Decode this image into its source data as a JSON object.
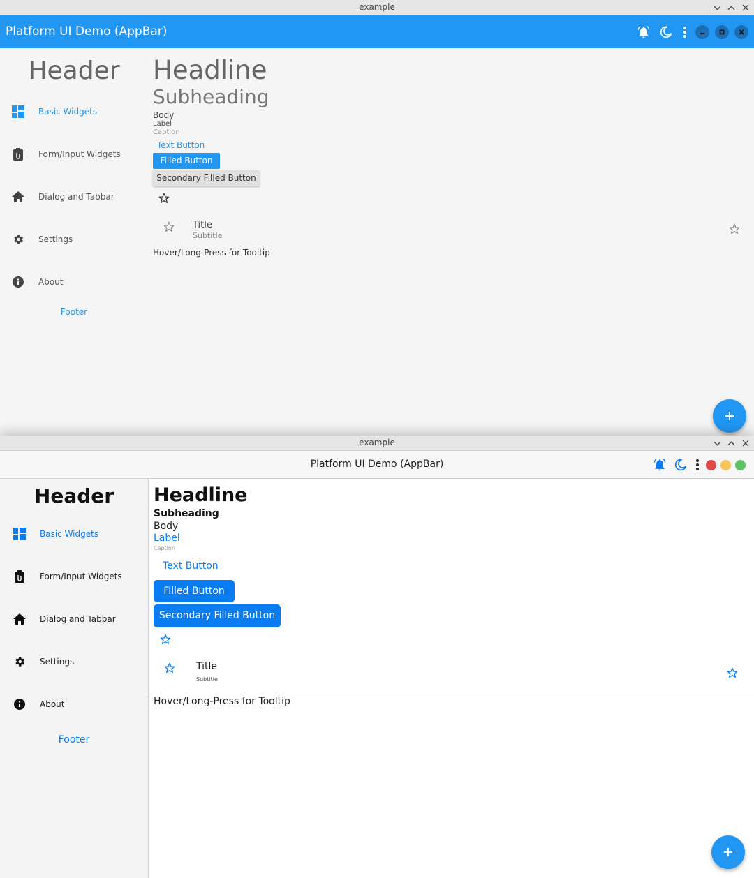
{
  "colors": {
    "accent": "#2196f3",
    "accent2": "#0a7cf2",
    "close_red": "#e54848",
    "min_yellow": "#f8c55a",
    "max_green": "#5cc266"
  },
  "window1": {
    "window_title": "example",
    "appbar_title": "Platform UI Demo (AppBar)",
    "sidebar": {
      "header": "Header",
      "items": [
        {
          "label": "Basic Widgets",
          "icon": "dashboard-icon"
        },
        {
          "label": "Form/Input Widgets",
          "icon": "clipboard-icon"
        },
        {
          "label": "Dialog and Tabbar",
          "icon": "home-icon"
        },
        {
          "label": "Settings",
          "icon": "gear-icon"
        },
        {
          "label": "About",
          "icon": "info-icon"
        }
      ],
      "footer": "Footer"
    },
    "content": {
      "headline": "Headline",
      "subheading": "Subheading",
      "body": "Body",
      "label": "Label",
      "caption": "Caption",
      "text_button": "Text Button",
      "filled_button": "Filled Button",
      "secondary_button": "Secondary Filled Button",
      "list_title": "Title",
      "list_subtitle": "Subtitle",
      "tooltip_text": "Hover/Long-Press for Tooltip"
    }
  },
  "window2": {
    "window_title": "example",
    "appbar_title": "Platform UI Demo (AppBar)",
    "sidebar": {
      "header": "Header",
      "items": [
        {
          "label": "Basic Widgets",
          "icon": "dashboard-icon"
        },
        {
          "label": "Form/Input Widgets",
          "icon": "clipboard-icon"
        },
        {
          "label": "Dialog and Tabbar",
          "icon": "home-icon"
        },
        {
          "label": "Settings",
          "icon": "gear-icon"
        },
        {
          "label": "About",
          "icon": "info-icon"
        }
      ],
      "footer": "Footer"
    },
    "content": {
      "headline": "Headline",
      "subheading": "Subheading",
      "body": "Body",
      "label": "Label",
      "caption": "Caption",
      "text_button": "Text Button",
      "filled_button": "Filled Button",
      "secondary_button": "Secondary Filled Button",
      "list_title": "Title",
      "list_subtitle": "Subtitle",
      "tooltip_text": "Hover/Long-Press for Tooltip"
    }
  }
}
